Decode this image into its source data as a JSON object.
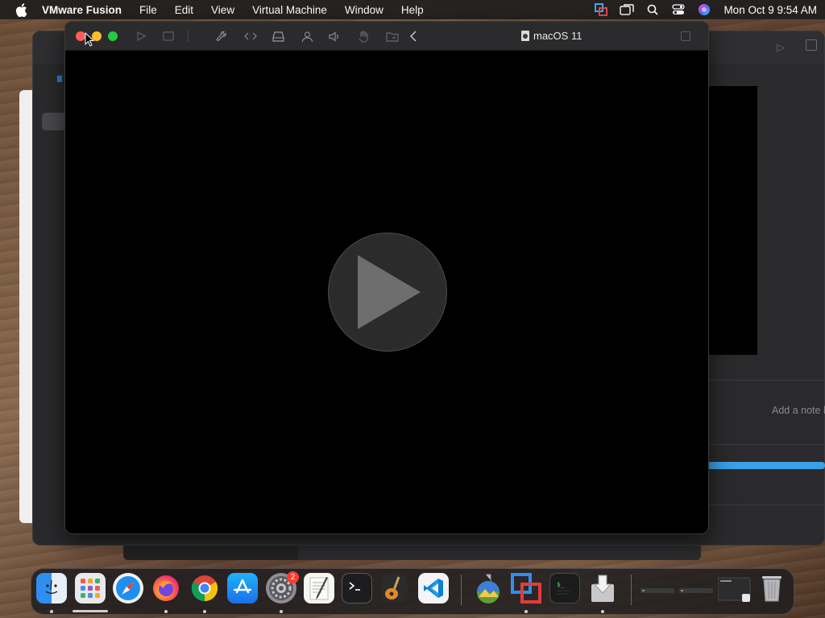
{
  "menubar": {
    "app_name": "VMware Fusion",
    "menus": [
      "File",
      "Edit",
      "View",
      "Virtual Machine",
      "Window",
      "Help"
    ],
    "status_icons": [
      "vmware-menu-icon",
      "screen-mirroring-icon",
      "spotlight-search-icon",
      "control-center-icon",
      "siri-icon"
    ],
    "clock": "Mon Oct 9  9:54 AM"
  },
  "vm_window": {
    "title": "macOS 11",
    "toolbar_icons": [
      "play-icon",
      "snapshot-icon",
      "settings-wrench-icon",
      "code-arrows-icon",
      "drive-icon",
      "user-share-icon",
      "sound-icon",
      "hand-icon",
      "shared-folder-icon",
      "back-chevron-icon"
    ],
    "play_button": "large-play-icon"
  },
  "library_window": {
    "note_placeholder": "Add a note h"
  },
  "dock": {
    "apps": [
      {
        "name": "Finder",
        "icon": "finder-icon"
      },
      {
        "name": "Launchpad",
        "icon": "launchpad-icon"
      },
      {
        "name": "Safari",
        "icon": "safari-icon"
      },
      {
        "name": "Firefox",
        "icon": "firefox-icon"
      },
      {
        "name": "Chrome",
        "icon": "chrome-icon"
      },
      {
        "name": "App Store",
        "icon": "app-store-icon"
      },
      {
        "name": "System Preferences",
        "icon": "system-preferences-icon"
      },
      {
        "name": "TextEdit",
        "icon": "textedit-icon"
      },
      {
        "name": "Terminal",
        "icon": "terminal-icon"
      },
      {
        "name": "GarageBand",
        "icon": "garageband-icon"
      },
      {
        "name": "Visual Studio Code",
        "icon": "vscode-icon"
      },
      {
        "name": "Install macOS",
        "icon": "install-macos-icon"
      },
      {
        "name": "VMware Fusion",
        "icon": "vmware-fusion-icon"
      },
      {
        "name": "Console",
        "icon": "console-icon"
      },
      {
        "name": "Downloads",
        "icon": "downloads-icon"
      },
      {
        "name": "Trash",
        "icon": "trash-icon"
      }
    ],
    "system_prefs_badge": "2"
  },
  "colors": {
    "close": "#ff5f57",
    "minimize": "#febc2e",
    "maximize": "#28c840",
    "accent_blue": "#3aa0e8"
  }
}
